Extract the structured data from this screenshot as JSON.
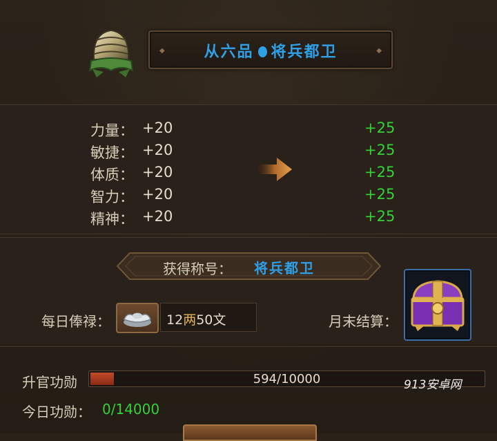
{
  "header": {
    "rank": "从六品",
    "position": "将兵都卫"
  },
  "stats": [
    {
      "label": "力量：",
      "current": "+20",
      "next": "+25"
    },
    {
      "label": "敏捷：",
      "current": "+20",
      "next": "+25"
    },
    {
      "label": "体质：",
      "current": "+20",
      "next": "+25"
    },
    {
      "label": "智力：",
      "current": "+20",
      "next": "+25"
    },
    {
      "label": "精神：",
      "current": "+20",
      "next": "+25"
    }
  ],
  "title_section": {
    "label": "获得称号：",
    "value": "将兵都卫"
  },
  "salary": {
    "label": "每日俸禄：",
    "amount1": "12",
    "unit1": "两",
    "amount2": "50",
    "unit2": "文",
    "icon": "silver-ingot-icon"
  },
  "month_end": {
    "label": "月末结算：",
    "icon": "treasure-chest-icon"
  },
  "promotion": {
    "label": "升官功勋",
    "progress_text": "594/10000",
    "current": 594,
    "max": 10000
  },
  "today": {
    "label": "今日功勋：",
    "value": "0/14000"
  },
  "watermark": "913安卓网",
  "colors": {
    "title_blue": "#2f9fe6",
    "bonus_green": "#35d235",
    "panel_bg": "#2a221a"
  }
}
